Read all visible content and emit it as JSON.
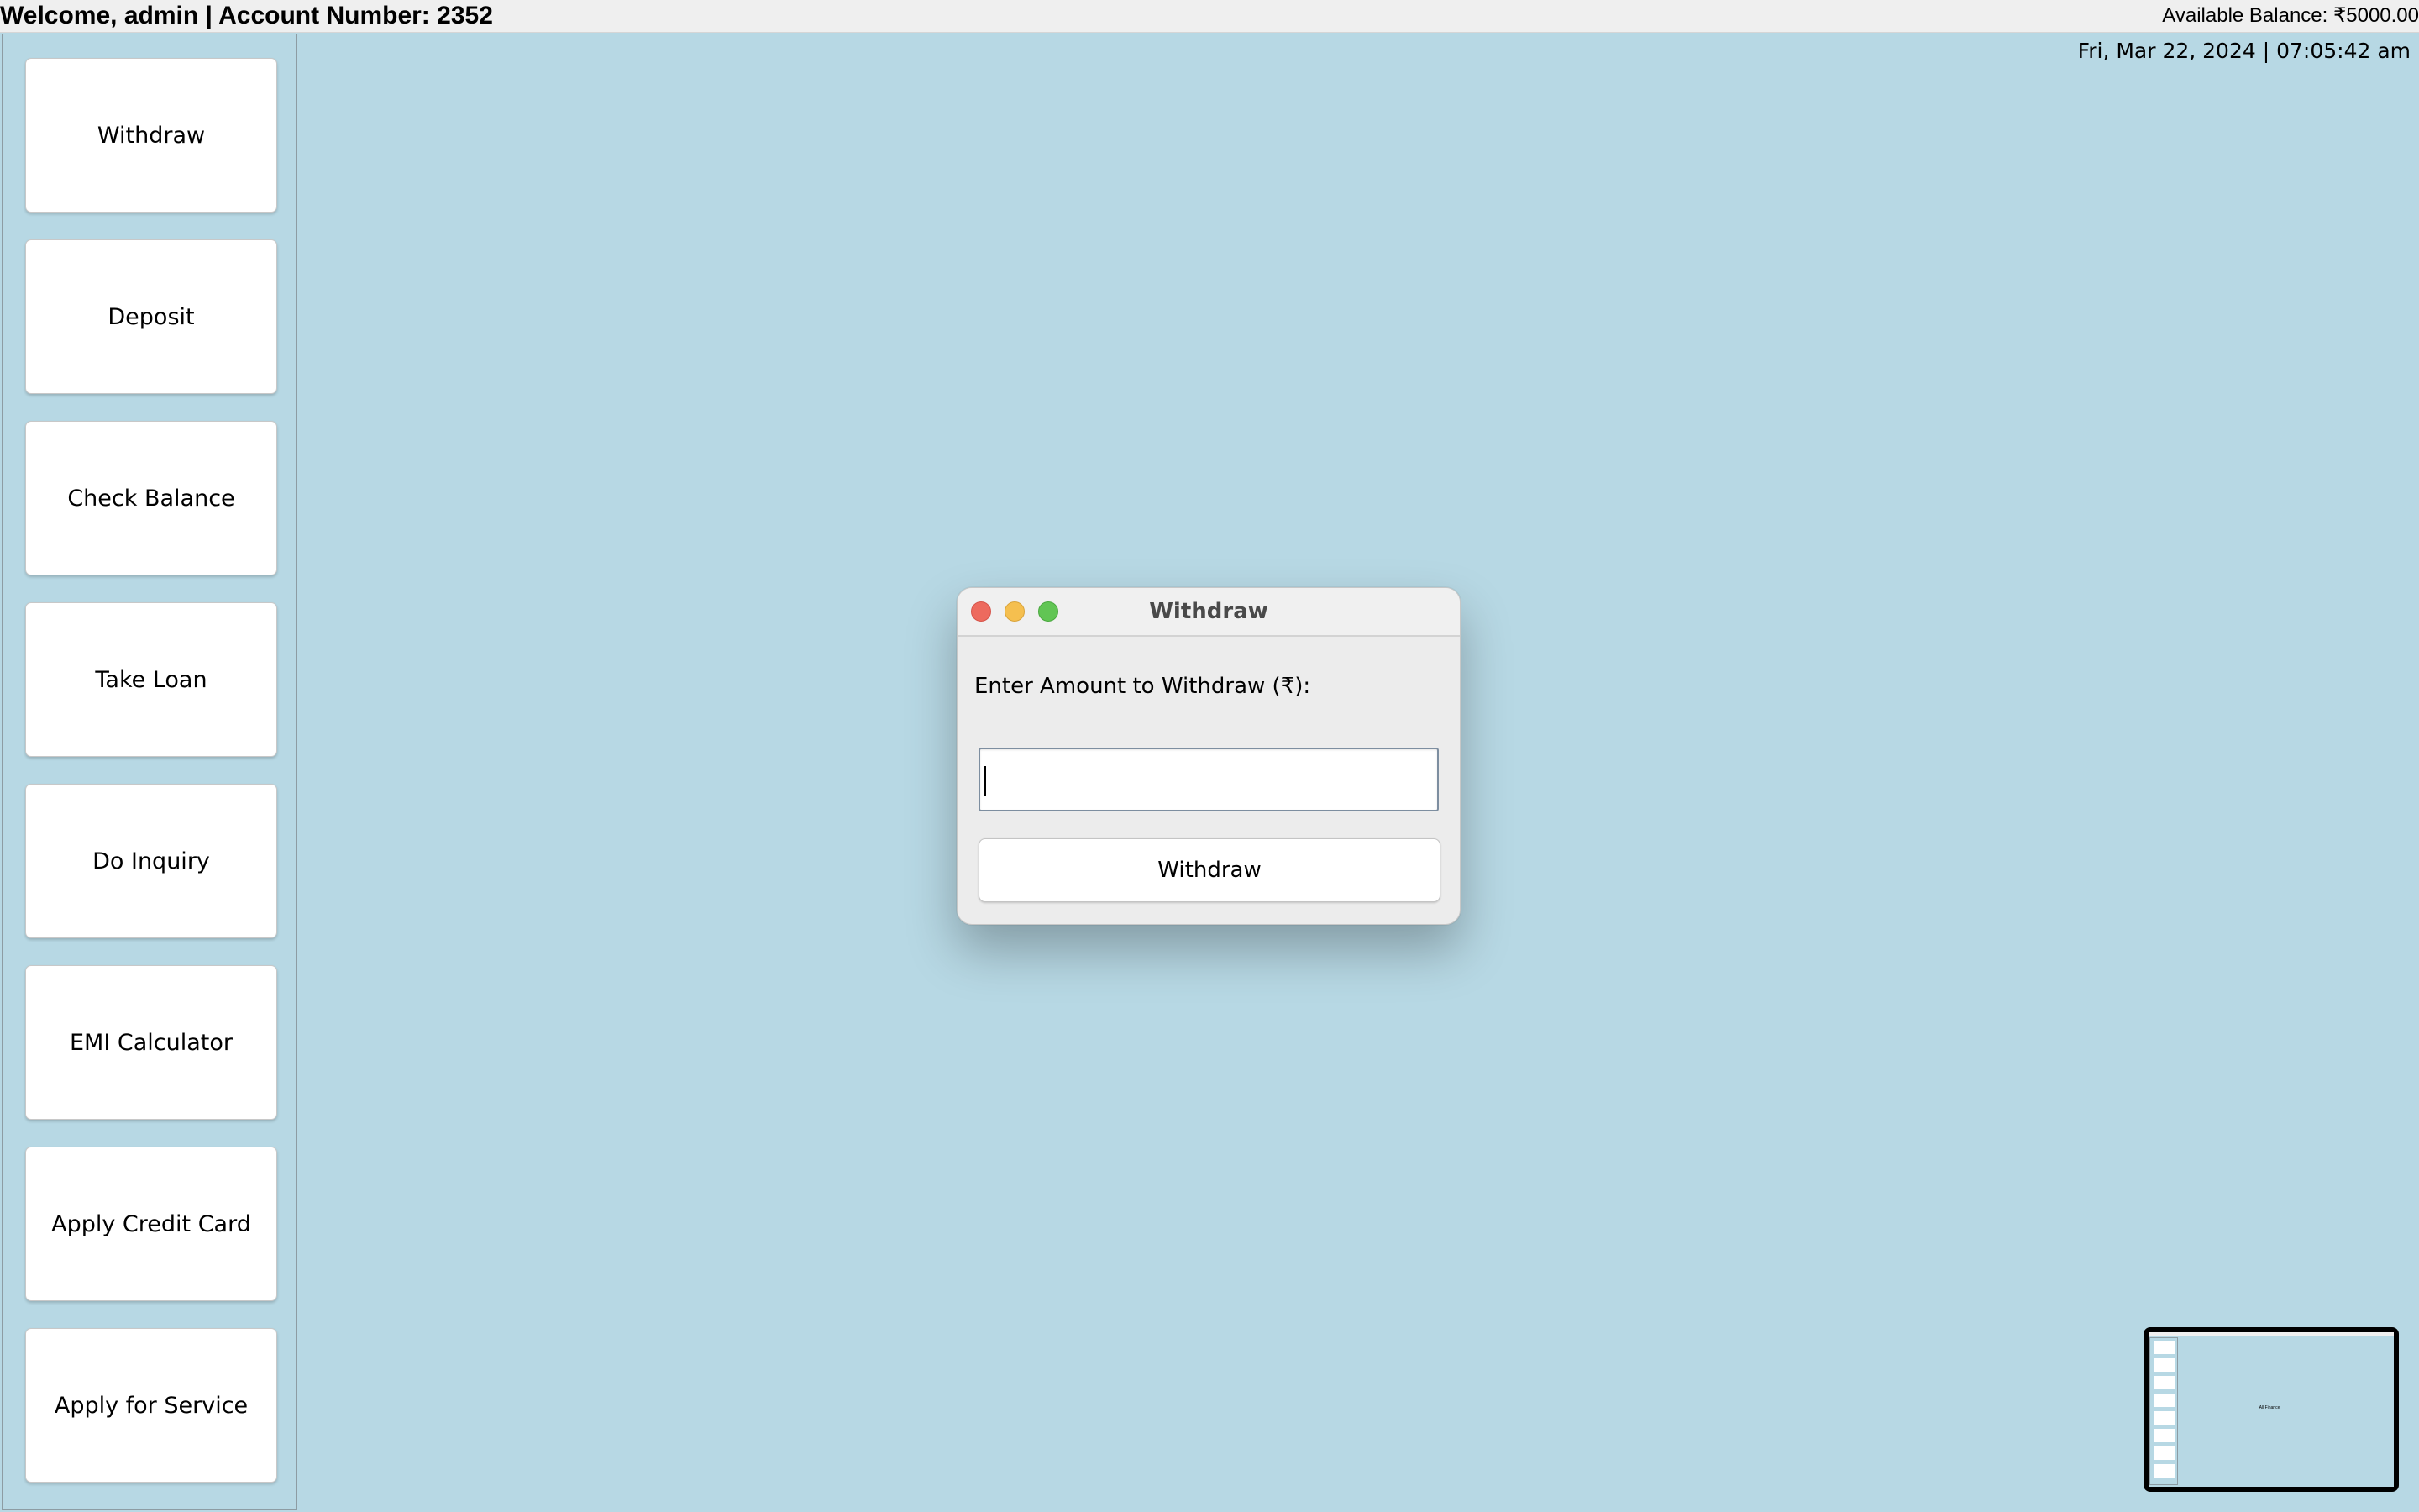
{
  "header": {
    "welcome": "Welcome, admin | Account Number: 2352",
    "balance": "Available Balance: ₹5000.00"
  },
  "datetime": "Fri, Mar 22, 2024 | 07:05:42 am",
  "sidebar": {
    "items": [
      {
        "label": "Withdraw"
      },
      {
        "label": "Deposit"
      },
      {
        "label": "Check Balance"
      },
      {
        "label": "Take Loan"
      },
      {
        "label": "Do Inquiry"
      },
      {
        "label": "EMI Calculator"
      },
      {
        "label": "Apply Credit Card"
      },
      {
        "label": "Apply for Service"
      }
    ]
  },
  "dialog": {
    "title": "Withdraw",
    "prompt": "Enter Amount to Withdraw (₹):",
    "input_value": "",
    "button_label": "Withdraw"
  },
  "thumbnail": {
    "caption": "All Finance"
  },
  "colors": {
    "background": "#b7d8e4",
    "header": "#efefef",
    "close": "#ed6a5e",
    "minimize": "#f5bf4f",
    "maximize": "#61c554"
  }
}
